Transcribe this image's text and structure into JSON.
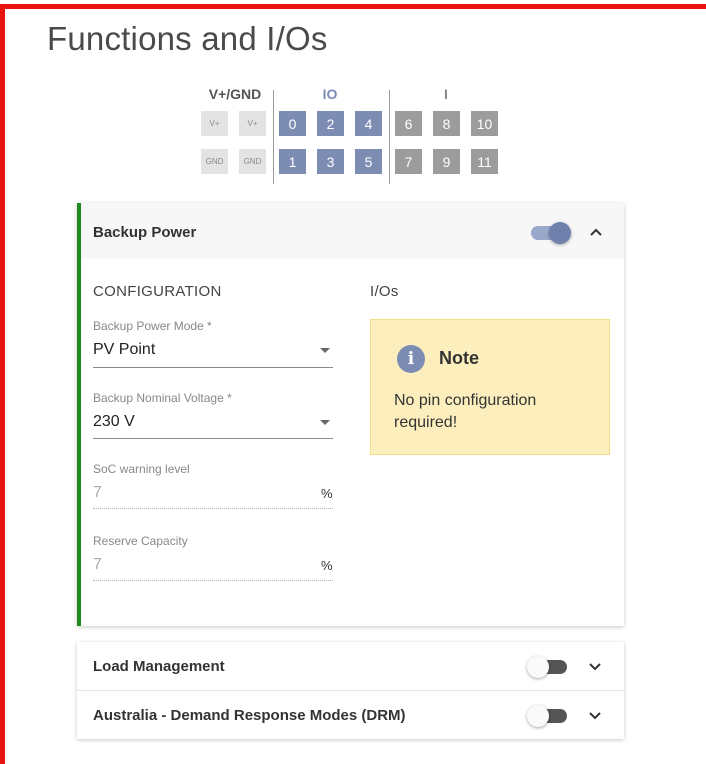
{
  "page": {
    "title": "Functions and I/Os"
  },
  "pins": {
    "groups": {
      "power": "V+/GND",
      "io": "IO",
      "input": "I"
    },
    "power_top": [
      "V+",
      "V+"
    ],
    "power_bottom": [
      "GND",
      "GND"
    ],
    "io_top": [
      "0",
      "2",
      "4"
    ],
    "io_bottom": [
      "1",
      "3",
      "5"
    ],
    "input_top": [
      "6",
      "8",
      "10"
    ],
    "input_bottom": [
      "7",
      "9",
      "11"
    ]
  },
  "backup_power": {
    "title": "Backup Power",
    "enabled": true,
    "configuration_heading": "CONFIGURATION",
    "ios_heading": "I/Os",
    "mode": {
      "label": "Backup Power Mode *",
      "value": "PV Point"
    },
    "voltage": {
      "label": "Backup Nominal Voltage *",
      "value": "230 V"
    },
    "soc_warning": {
      "label": "SoC warning level",
      "value": "7",
      "unit": "%"
    },
    "reserve": {
      "label": "Reserve Capacity",
      "value": "7",
      "unit": "%"
    },
    "note": {
      "icon": "i",
      "title": "Note",
      "text": "No pin configuration required!"
    }
  },
  "load_management": {
    "title": "Load Management",
    "enabled": false
  },
  "drm": {
    "title": "Australia - Demand Response Modes (DRM)",
    "enabled": false
  },
  "colors": {
    "frame": "#e8140f",
    "accent_green": "#1f8a1f",
    "io_pin": "#7c8cb3",
    "input_pin": "#9c9c9c",
    "note_bg": "#fcefbd"
  }
}
